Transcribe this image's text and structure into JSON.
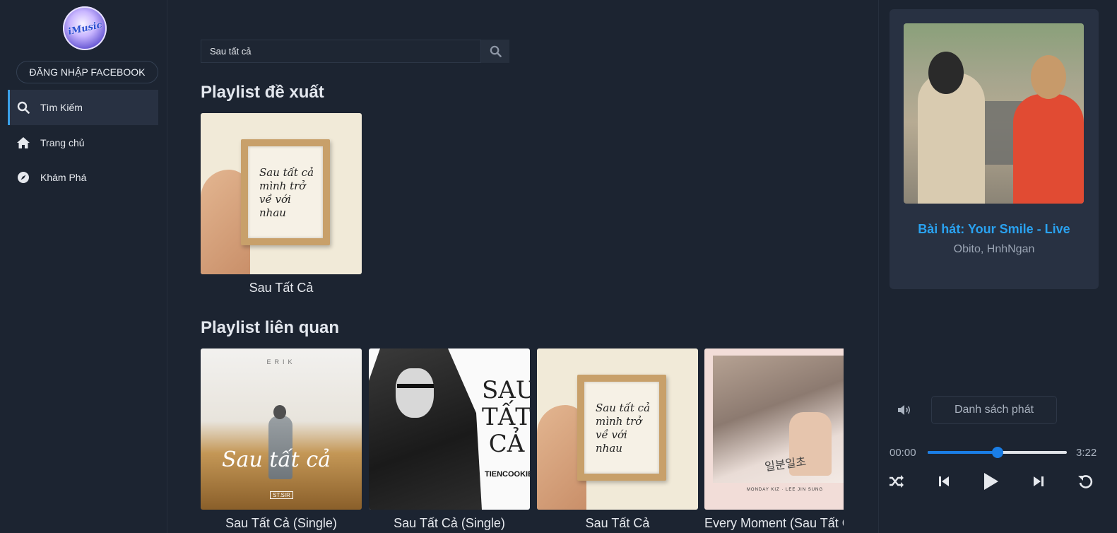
{
  "sidebar": {
    "logo_text": "iMusic",
    "facebook_login": "ĐĂNG NHẬP FACEBOOK",
    "items": [
      {
        "label": "Tìm Kiếm",
        "icon": "search-icon",
        "active": true
      },
      {
        "label": "Trang chủ",
        "icon": "home-icon",
        "active": false
      },
      {
        "label": "Khám Phá",
        "icon": "compass-icon",
        "active": false
      }
    ]
  },
  "search": {
    "value": "Sau tất cả",
    "icon": "search-icon"
  },
  "sections": {
    "suggested": {
      "title": "Playlist đề xuất",
      "items": [
        {
          "title": "Sau Tất Cả",
          "cover_text": "Sau tất cả mình trở về với nhau"
        }
      ]
    },
    "related": {
      "title": "Playlist liên quan",
      "items": [
        {
          "title": "Sau Tất Cả (Single)",
          "cover_text": "Sau tất cả",
          "cover_top": "ERIK",
          "cover_tag": "ST.SIR"
        },
        {
          "title": "Sau Tất Cả (Single)",
          "cover_text": "SAU TẤT CẢ",
          "cover_tag": "TIENCOOKIE"
        },
        {
          "title": "Sau Tất Cả",
          "cover_text": "Sau tất cả mình trở về với nhau"
        },
        {
          "title": "Every Moment (Sau Tất Cả)",
          "cover_text": "일분일초",
          "cover_tag": "MONDAY KIZ · LEE JIN SUNG"
        }
      ]
    }
  },
  "player": {
    "song_label": "Bài hát: Your Smile - Live",
    "artist": "Obito, HnhNgan",
    "playlist_button": "Danh sách phát",
    "current_time": "00:00",
    "total_time": "3:22",
    "progress_percent": 50,
    "colors": {
      "accent": "#2aa2f0",
      "progress": "#1a7ee6"
    },
    "controls": [
      "shuffle-icon",
      "previous-icon",
      "play-icon",
      "next-icon",
      "repeat-icon"
    ]
  }
}
